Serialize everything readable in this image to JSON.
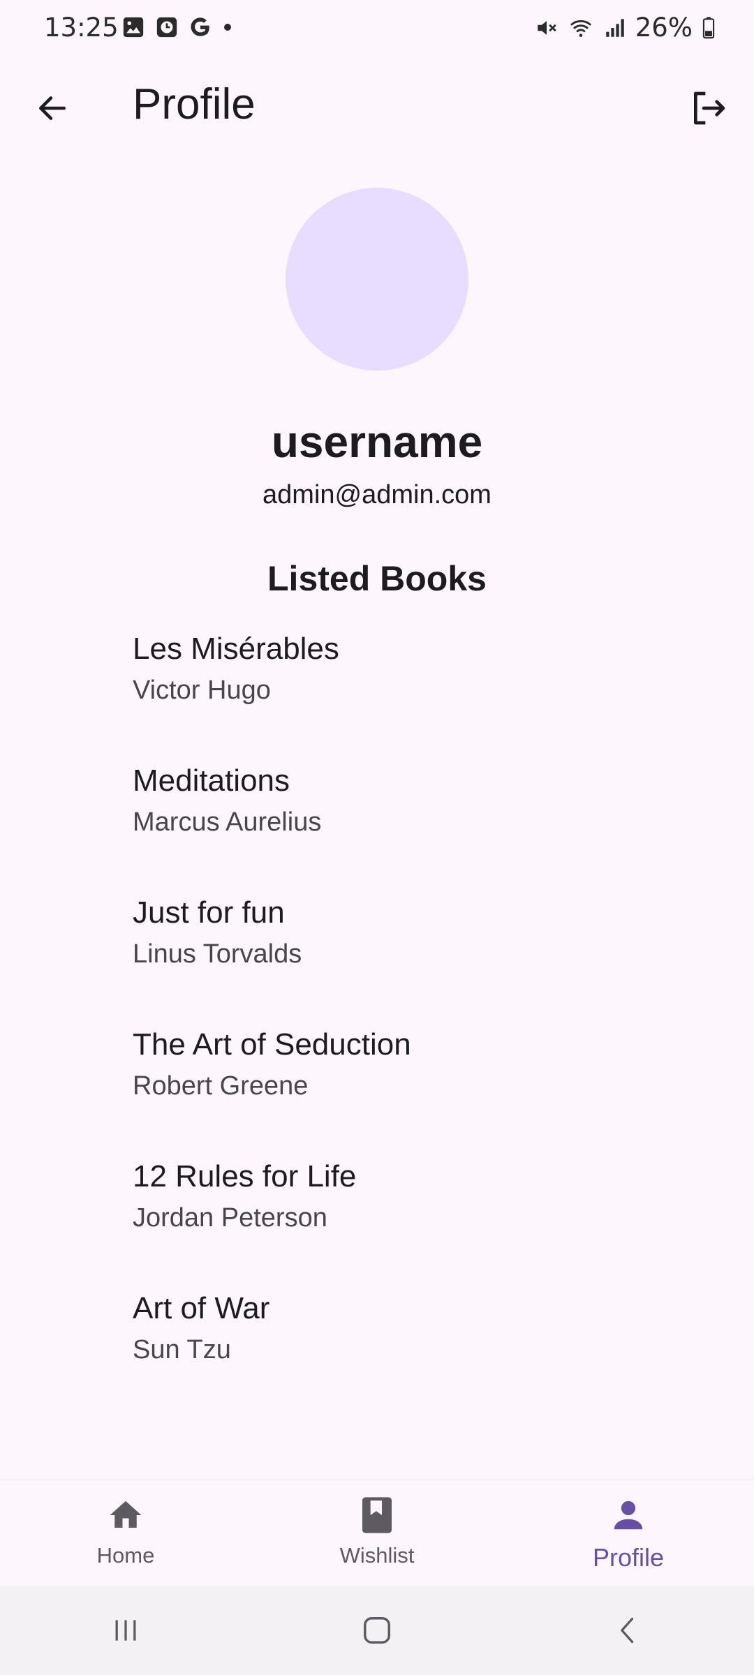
{
  "status_bar": {
    "time": "13:25",
    "battery": "26%",
    "icons": [
      "image-icon",
      "clock-app-icon",
      "google-icon",
      "dot-icon",
      "mute-icon",
      "wifi-icon",
      "signal-icon",
      "battery-icon"
    ]
  },
  "app_bar": {
    "title": "Profile",
    "back_icon": "arrow-back-icon",
    "logout_icon": "logout-icon"
  },
  "profile": {
    "username": "username",
    "email": "admin@admin.com",
    "avatar_color": "#e9ddff"
  },
  "listed_books": {
    "title": "Listed Books",
    "items": [
      {
        "title": "Les Misérables",
        "author": "Victor Hugo"
      },
      {
        "title": "Meditations",
        "author": "Marcus Aurelius"
      },
      {
        "title": "Just for fun",
        "author": "Linus Torvalds"
      },
      {
        "title": "The Art of Seduction",
        "author": "Robert Greene"
      },
      {
        "title": "12 Rules for Life",
        "author": "Jordan Peterson"
      },
      {
        "title": "Art of War",
        "author": "Sun Tzu"
      }
    ]
  },
  "bottom_nav": {
    "items": [
      {
        "label": "Home",
        "icon": "home-icon",
        "active": false
      },
      {
        "label": "Wishlist",
        "icon": "bookmark-book-icon",
        "active": false
      },
      {
        "label": "Profile",
        "icon": "person-icon",
        "active": true
      }
    ],
    "active_color": "#6750a4",
    "inactive_color": "#5e5a62"
  },
  "system_nav": {
    "buttons": [
      "recents-icon",
      "home-button-icon",
      "back-chevron-icon"
    ]
  }
}
